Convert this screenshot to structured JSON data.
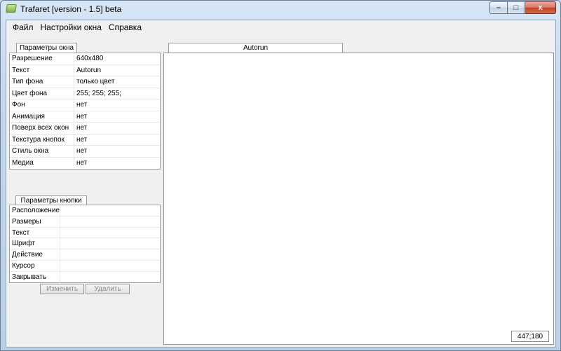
{
  "window": {
    "title": "Trafaret [version - 1.5] beta"
  },
  "caption_buttons": {
    "minimize": "–",
    "maximize": "□",
    "close": "x"
  },
  "menu": {
    "items": [
      "Файл",
      "Настройки окна",
      "Справка"
    ]
  },
  "window_params": {
    "tab_label": "Параметры окна",
    "rows": [
      {
        "name": "Разрешение",
        "value": "640x480"
      },
      {
        "name": "Текст",
        "value": "Autorun"
      },
      {
        "name": "Тип фона",
        "value": "только цвет"
      },
      {
        "name": "Цвет фона",
        "value": "255; 255; 255;"
      },
      {
        "name": "Фон",
        "value": "нет"
      },
      {
        "name": "Анимация",
        "value": "нет"
      },
      {
        "name": "Поверх всех окон",
        "value": "нет"
      },
      {
        "name": "Текстура кнопок",
        "value": "нет"
      },
      {
        "name": "Стиль окна",
        "value": "нет"
      },
      {
        "name": "Медиа",
        "value": "нет"
      }
    ]
  },
  "button_params": {
    "tab_label": "Параметры кнопки",
    "rows": [
      {
        "name": "Расположение",
        "value": ""
      },
      {
        "name": "Размеры",
        "value": ""
      },
      {
        "name": "Текст",
        "value": ""
      },
      {
        "name": "Шрифт",
        "value": ""
      },
      {
        "name": "Действие",
        "value": ""
      },
      {
        "name": "Курсор",
        "value": ""
      },
      {
        "name": "Закрывать",
        "value": ""
      }
    ],
    "edit_label": "Изменить",
    "delete_label": "Удалить"
  },
  "preview": {
    "tab_label": "Autorun",
    "coords": "447;180"
  }
}
